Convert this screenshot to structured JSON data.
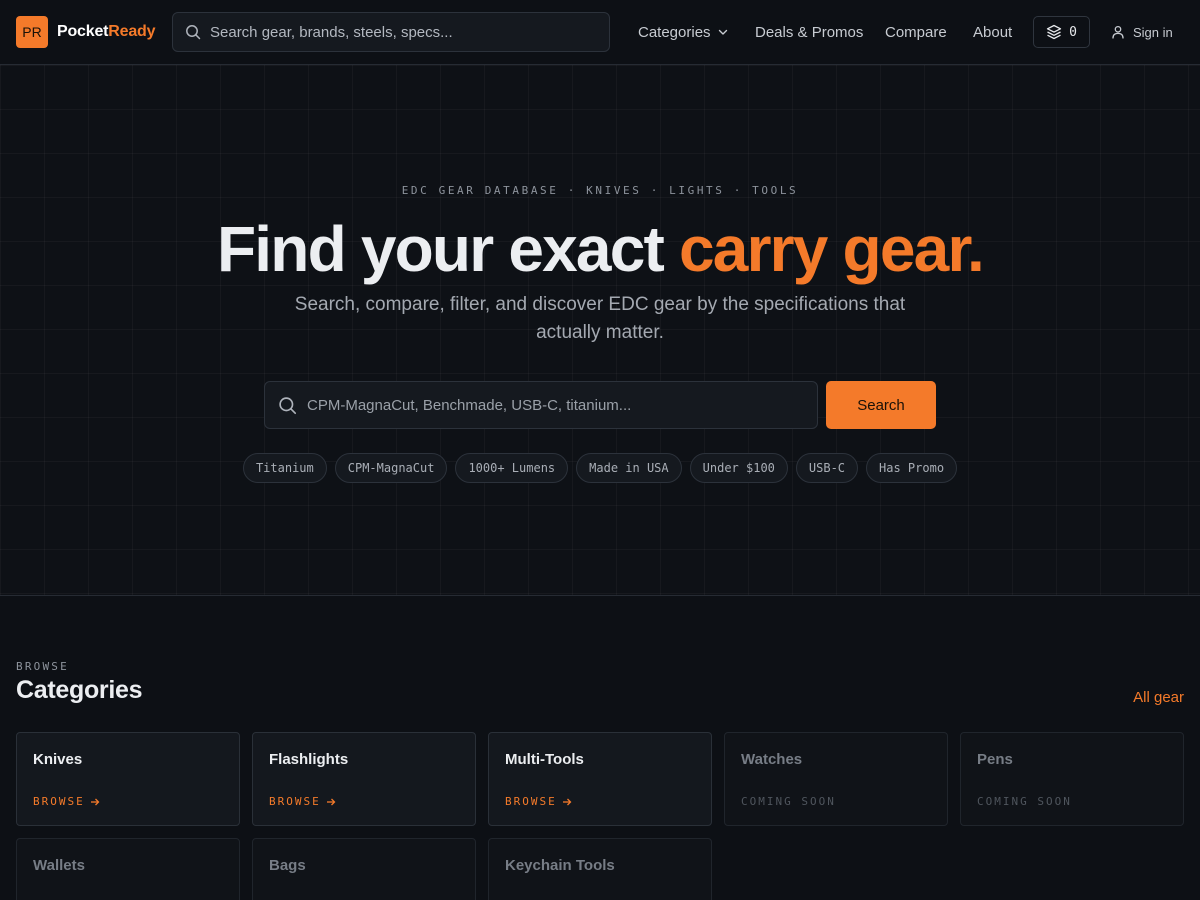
{
  "header": {
    "logo_badge": "PR",
    "logo_name_a": "Pocket",
    "logo_name_b": "Ready",
    "search_placeholder": "Search gear, brands, steels, specs...",
    "nav": {
      "categories": "Categories",
      "deals": "Deals & Promos",
      "compare": "Compare",
      "about": "About"
    },
    "compare_count": "0",
    "signin": "Sign in"
  },
  "hero": {
    "kicker": "EDC GEAR DATABASE · KNIVES · LIGHTS · TOOLS",
    "title_main": "Find your exact ",
    "title_accent": "carry gear.",
    "subtitle": "Search, compare, filter, and discover EDC gear by the specifications that actually matter.",
    "search_placeholder": "CPM-MagnaCut, Benchmade, USB-C, titanium...",
    "search_button": "Search",
    "chips": [
      "Titanium",
      "CPM-MagnaCut",
      "1000+ Lumens",
      "Made in USA",
      "Under $100",
      "USB-C",
      "Has Promo"
    ]
  },
  "browse": {
    "kicker": "BROWSE",
    "title": "Categories",
    "all_link": "All gear",
    "categories": [
      {
        "name": "Knives",
        "action": "BROWSE",
        "available": true
      },
      {
        "name": "Flashlights",
        "action": "BROWSE",
        "available": true
      },
      {
        "name": "Multi-Tools",
        "action": "BROWSE",
        "available": true
      },
      {
        "name": "Watches",
        "action": "COMING SOON",
        "available": false
      },
      {
        "name": "Pens",
        "action": "COMING SOON",
        "available": false
      },
      {
        "name": "Wallets",
        "action": "",
        "available": false
      },
      {
        "name": "Bags",
        "action": "",
        "available": false
      },
      {
        "name": "Keychain Tools",
        "action": "",
        "available": false
      }
    ]
  },
  "colors": {
    "accent": "#f47a2a",
    "background": "#0d1015"
  }
}
